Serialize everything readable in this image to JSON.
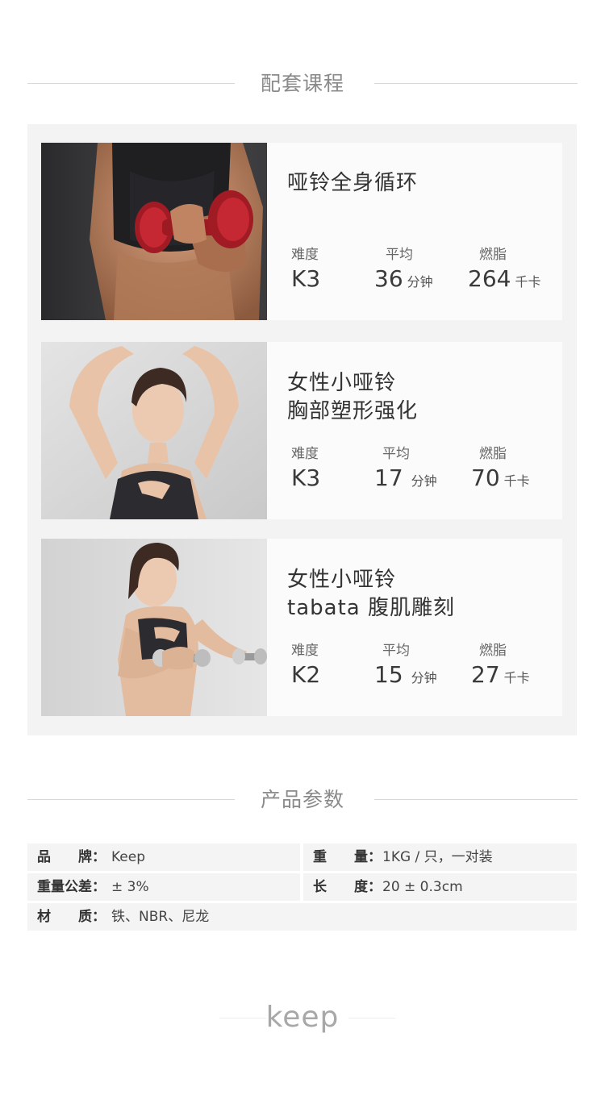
{
  "courses_section": {
    "title": "配套课程"
  },
  "courses": [
    {
      "title_line1": "哑铃全身循环",
      "title_line2": "",
      "difficulty_label": "难度",
      "difficulty": "K3",
      "avg_label": "平均",
      "avg_value": "36",
      "avg_unit": "分钟",
      "burn_label": "燃脂",
      "burn_value": "264",
      "burn_unit": "千卡"
    },
    {
      "title_line1": "女性小哑铃",
      "title_line2": "胸部塑形强化",
      "difficulty_label": "难度",
      "difficulty": "K3",
      "avg_label": "平均",
      "avg_value": "17",
      "avg_unit": "分钟",
      "burn_label": "燃脂",
      "burn_value": "70",
      "burn_unit": "千卡"
    },
    {
      "title_line1": "女性小哑铃",
      "title_line2": "tabata 腹肌雕刻",
      "difficulty_label": "难度",
      "difficulty": "K2",
      "avg_label": "平均",
      "avg_value": "15",
      "avg_unit": "分钟",
      "burn_label": "燃脂",
      "burn_value": "27",
      "burn_unit": "千卡"
    }
  ],
  "params_section": {
    "title": "产品参数"
  },
  "params": {
    "brand_key": "品　　牌：",
    "brand_value": "Keep",
    "weight_key": "重　　量：",
    "weight_value": "1KG / 只，一对装",
    "tolerance_key": "重量公差：",
    "tolerance_value": "± 3%",
    "length_key": "长　　度：",
    "length_value": "20 ± 0.3cm",
    "material_key": "材　　质：",
    "material_value": "铁、NBR、尼龙"
  },
  "footer": {
    "logo_text": "keep"
  },
  "colors": {
    "dumbbell_red": "#b3202a",
    "sportswear": "#2a2a2e",
    "accent_gray": "#8a8a8a"
  }
}
